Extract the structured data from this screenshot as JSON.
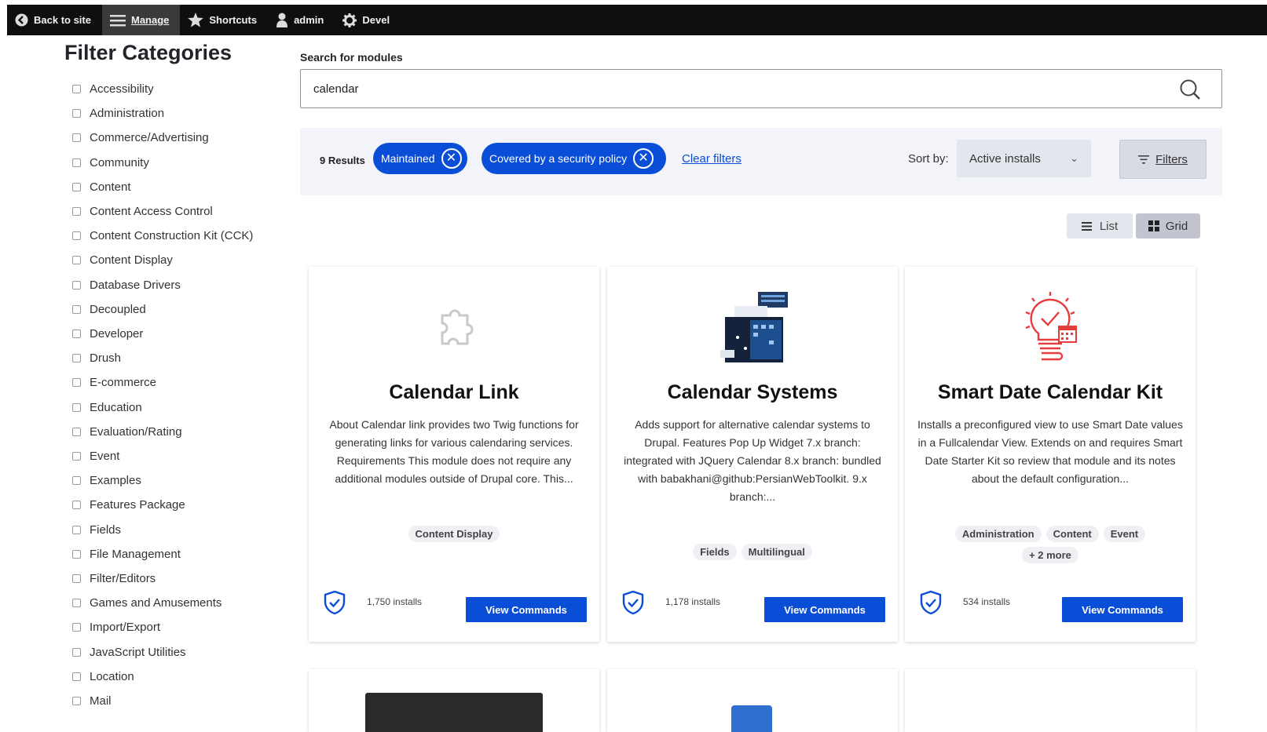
{
  "toolbar": {
    "back": "Back to site",
    "manage": "Manage",
    "shortcuts": "Shortcuts",
    "user": "admin",
    "devel": "Devel"
  },
  "sidebar": {
    "title": "Filter Categories",
    "categories": [
      "Accessibility",
      "Administration",
      "Commerce/Advertising",
      "Community",
      "Content",
      "Content Access Control",
      "Content Construction Kit (CCK)",
      "Content Display",
      "Database Drivers",
      "Decoupled",
      "Developer",
      "Drush",
      "E-commerce",
      "Education",
      "Evaluation/Rating",
      "Event",
      "Examples",
      "Features Package",
      "Fields",
      "File Management",
      "Filter/Editors",
      "Games and Amusements",
      "Import/Export",
      "JavaScript Utilities",
      "Location",
      "Mail"
    ]
  },
  "search": {
    "label": "Search for modules",
    "value": "calendar"
  },
  "filters": {
    "results": "9 Results",
    "pill_maintained": "Maintained",
    "pill_security": "Covered by a security policy",
    "clear": "Clear filters",
    "sort_label": "Sort by:",
    "sort_value": "Active installs",
    "filters_button": "Filters"
  },
  "view": {
    "list": "List",
    "grid": "Grid"
  },
  "cards": [
    {
      "title": "Calendar Link",
      "description": "About Calendar link provides two Twig functions for generating links for various calendaring services. Requirements This module does not require any additional modules outside of Drupal core. This...",
      "tags": [
        "Content Display"
      ],
      "installs": "1,750 installs",
      "button": "View Commands",
      "icon": "puzzle-icon"
    },
    {
      "title": "Calendar Systems",
      "description": "Adds support for alternative calendar systems to Drupal. Features Pop Up Widget 7.x branch: integrated with JQuery Calendar 8.x branch: bundled with babakhani@github:PersianWebToolkit. 9.x branch:...",
      "tags": [
        "Fields",
        "Multilingual"
      ],
      "installs": "1,178 installs",
      "button": "View Commands",
      "icon": "calendar-screens-icon"
    },
    {
      "title": "Smart Date Calendar Kit",
      "description": "Installs a preconfigured view to use Smart Date values in a Fullcalendar View. Extends on and requires Smart Date Starter Kit so review that module and its notes about the default configuration...",
      "tags": [
        "Administration",
        "Content",
        "Event",
        "+ 2 more"
      ],
      "installs": "534 installs",
      "button": "View Commands",
      "icon": "clock-calendar-icon"
    }
  ],
  "colors": {
    "accent": "#0a4dd6",
    "toolbar": "#0f0f0f",
    "filter_bg": "#f3f4f9"
  }
}
